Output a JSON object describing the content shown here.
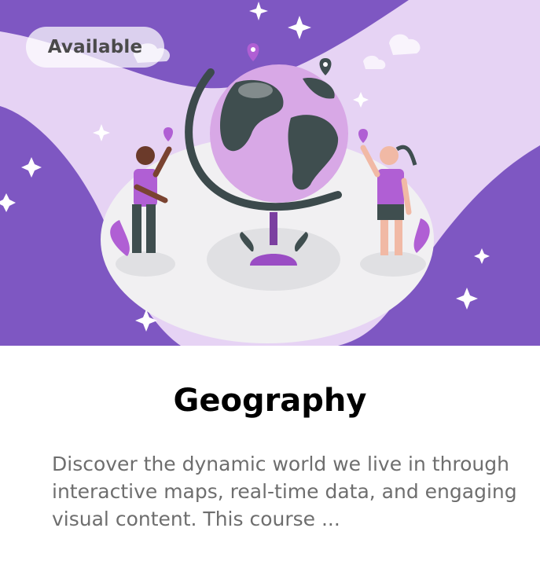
{
  "card": {
    "status_badge": "Available",
    "title": "Geography",
    "description": "Discover the dynamic world we live in through interactive maps, real-time data, and engaging visual content. This course ...",
    "illustration_icon": "globe-with-kids-illustration"
  },
  "colors": {
    "hero_dark_purple": "#7e57c2",
    "hero_light_purple": "#e6d3f4",
    "accent_purple": "#a35bd1",
    "title_text": "#000000",
    "body_text": "#6e6e6e",
    "badge_text": "#4a4a4a"
  }
}
